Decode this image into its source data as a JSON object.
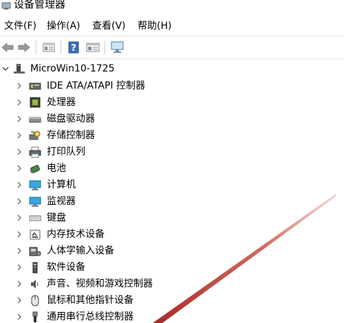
{
  "window": {
    "title": "设备管理器",
    "title_icon": "device-manager-icon"
  },
  "menu": [
    {
      "id": "file",
      "label": "文件(F)"
    },
    {
      "id": "action",
      "label": "操作(A)"
    },
    {
      "id": "view",
      "label": "查看(V)"
    },
    {
      "id": "help",
      "label": "帮助(H)"
    }
  ],
  "toolbar": [
    {
      "id": "back",
      "icon": "back-arrow-icon"
    },
    {
      "id": "forward",
      "icon": "forward-arrow-icon"
    },
    {
      "id": "properties",
      "icon": "properties-icon"
    },
    {
      "id": "help",
      "icon": "help-icon"
    },
    {
      "id": "details",
      "icon": "details-view-icon"
    },
    {
      "id": "scan",
      "icon": "scan-monitor-icon"
    }
  ],
  "tree": {
    "root": {
      "label": "MicroWin10-1725",
      "expanded": true,
      "icon": "computer-icon"
    },
    "items": [
      {
        "label": "IDE ATA/ATAPI 控制器",
        "icon": "ide-controller-icon"
      },
      {
        "label": "处理器",
        "icon": "processor-icon"
      },
      {
        "label": "磁盘驱动器",
        "icon": "disk-drive-icon"
      },
      {
        "label": "存储控制器",
        "icon": "storage-controller-icon"
      },
      {
        "label": "打印队列",
        "icon": "printer-icon"
      },
      {
        "label": "电池",
        "icon": "battery-icon"
      },
      {
        "label": "计算机",
        "icon": "computer-monitor-icon"
      },
      {
        "label": "监视器",
        "icon": "monitor-icon"
      },
      {
        "label": "键盘",
        "icon": "keyboard-icon"
      },
      {
        "label": "内存技术设备",
        "icon": "memory-device-icon"
      },
      {
        "label": "人体学输入设备",
        "icon": "hid-icon"
      },
      {
        "label": "软件设备",
        "icon": "software-device-icon"
      },
      {
        "label": "声音、视频和游戏控制器",
        "icon": "speaker-icon"
      },
      {
        "label": "鼠标和其他指针设备",
        "icon": "mouse-icon"
      },
      {
        "label": "通用串行总线控制器",
        "icon": "usb-icon"
      }
    ]
  },
  "colors": {
    "annotation_line": "#c0392b",
    "chevron": "#6b6b6b"
  }
}
